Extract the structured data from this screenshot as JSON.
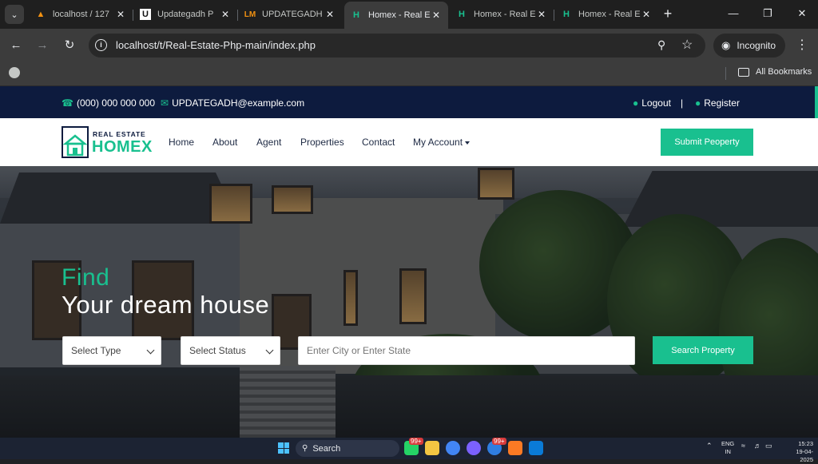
{
  "browser": {
    "tabs": [
      {
        "title": "localhost / 127",
        "favicon": "phpmyadmin-icon",
        "active": false
      },
      {
        "title": "Updategadh P",
        "favicon": "updategadh-icon",
        "active": false
      },
      {
        "title": "UPDATEGADH",
        "favicon": "lm-icon",
        "active": false
      },
      {
        "title": "Homex - Real E",
        "favicon": "homex-icon",
        "active": true
      },
      {
        "title": "Homex - Real E",
        "favicon": "homex-icon",
        "active": false
      },
      {
        "title": "Homex - Real E",
        "favicon": "homex-icon",
        "active": false
      }
    ],
    "url": "localhost/t/Real-Estate-Php-main/index.php",
    "incognito_label": "Incognito",
    "all_bookmarks_label": "All Bookmarks"
  },
  "site": {
    "topbar": {
      "phone": "(000) 000 000 000",
      "email": "UPDATEGADH@example.com",
      "logout_label": "Logout",
      "separator": "|",
      "register_label": "Register"
    },
    "logo": {
      "line1": "REAL ESTATE",
      "line2": "HOMEX"
    },
    "nav": {
      "home": "Home",
      "about": "About",
      "agent": "Agent",
      "properties": "Properties",
      "contact": "Contact",
      "my_account": "My Account",
      "submit_label": "Submit Peoperty"
    },
    "hero": {
      "find": "Find",
      "headline": "Your dream house",
      "type_select": "Select Type",
      "status_select": "Select Status",
      "search_placeholder": "Enter City or Enter State",
      "search_button": "Search Property"
    }
  },
  "taskbar": {
    "search_label": "Search",
    "badge_1": "99+",
    "badge_2": "99+",
    "lang_line1": "ENG",
    "lang_line2": "IN",
    "time": "15:23",
    "date": "19-04-2025"
  },
  "colors": {
    "brand_green": "#19c08f",
    "navy": "#0d1b3e"
  }
}
